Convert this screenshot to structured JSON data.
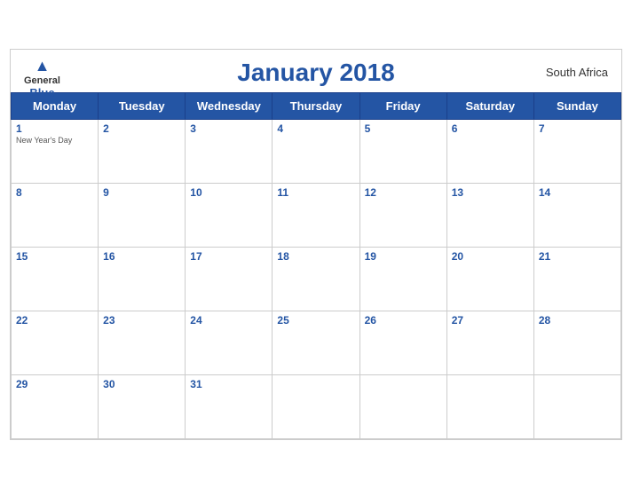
{
  "header": {
    "logo": {
      "general": "General",
      "blue": "Blue",
      "bird": "▲"
    },
    "title": "January 2018",
    "country": "South Africa"
  },
  "days_of_week": [
    "Monday",
    "Tuesday",
    "Wednesday",
    "Thursday",
    "Friday",
    "Saturday",
    "Sunday"
  ],
  "weeks": [
    [
      {
        "day": 1,
        "holiday": "New Year's Day"
      },
      {
        "day": 2,
        "holiday": ""
      },
      {
        "day": 3,
        "holiday": ""
      },
      {
        "day": 4,
        "holiday": ""
      },
      {
        "day": 5,
        "holiday": ""
      },
      {
        "day": 6,
        "holiday": ""
      },
      {
        "day": 7,
        "holiday": ""
      }
    ],
    [
      {
        "day": 8,
        "holiday": ""
      },
      {
        "day": 9,
        "holiday": ""
      },
      {
        "day": 10,
        "holiday": ""
      },
      {
        "day": 11,
        "holiday": ""
      },
      {
        "day": 12,
        "holiday": ""
      },
      {
        "day": 13,
        "holiday": ""
      },
      {
        "day": 14,
        "holiday": ""
      }
    ],
    [
      {
        "day": 15,
        "holiday": ""
      },
      {
        "day": 16,
        "holiday": ""
      },
      {
        "day": 17,
        "holiday": ""
      },
      {
        "day": 18,
        "holiday": ""
      },
      {
        "day": 19,
        "holiday": ""
      },
      {
        "day": 20,
        "holiday": ""
      },
      {
        "day": 21,
        "holiday": ""
      }
    ],
    [
      {
        "day": 22,
        "holiday": ""
      },
      {
        "day": 23,
        "holiday": ""
      },
      {
        "day": 24,
        "holiday": ""
      },
      {
        "day": 25,
        "holiday": ""
      },
      {
        "day": 26,
        "holiday": ""
      },
      {
        "day": 27,
        "holiday": ""
      },
      {
        "day": 28,
        "holiday": ""
      }
    ],
    [
      {
        "day": 29,
        "holiday": ""
      },
      {
        "day": 30,
        "holiday": ""
      },
      {
        "day": 31,
        "holiday": ""
      },
      {
        "day": null,
        "holiday": ""
      },
      {
        "day": null,
        "holiday": ""
      },
      {
        "day": null,
        "holiday": ""
      },
      {
        "day": null,
        "holiday": ""
      }
    ]
  ]
}
